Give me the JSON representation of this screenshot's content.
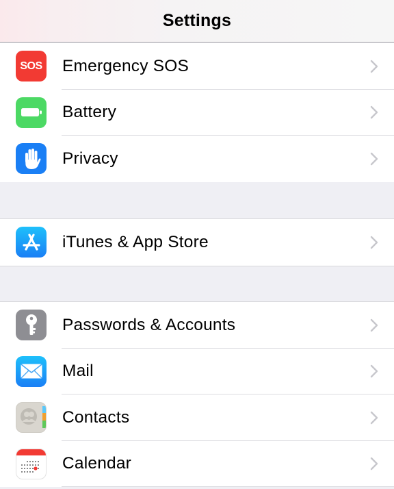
{
  "navbar": {
    "title": "Settings"
  },
  "colors": {
    "sos": "#f23a33",
    "battery": "#4cd964",
    "privacy": "#1a7ff5",
    "app_store": "#1b9af7",
    "passwords": "#8e8e93",
    "mail": "#1a8cf5",
    "contacts": "#d9d6cf",
    "calendar_red": "#f23a33",
    "chevron": "#c7c7cc",
    "group_background": "#efeff4"
  },
  "sections": [
    {
      "items": [
        {
          "label": "Emergency SOS",
          "icon": "sos-icon",
          "icon_text": "SOS"
        },
        {
          "label": "Battery",
          "icon": "battery-icon"
        },
        {
          "label": "Privacy",
          "icon": "hand-icon"
        }
      ]
    },
    {
      "items": [
        {
          "label": "iTunes & App Store",
          "icon": "app-store-icon"
        }
      ]
    },
    {
      "items": [
        {
          "label": "Passwords & Accounts",
          "icon": "key-icon"
        },
        {
          "label": "Mail",
          "icon": "envelope-icon"
        },
        {
          "label": "Contacts",
          "icon": "contacts-icon"
        },
        {
          "label": "Calendar",
          "icon": "calendar-icon"
        }
      ]
    }
  ]
}
